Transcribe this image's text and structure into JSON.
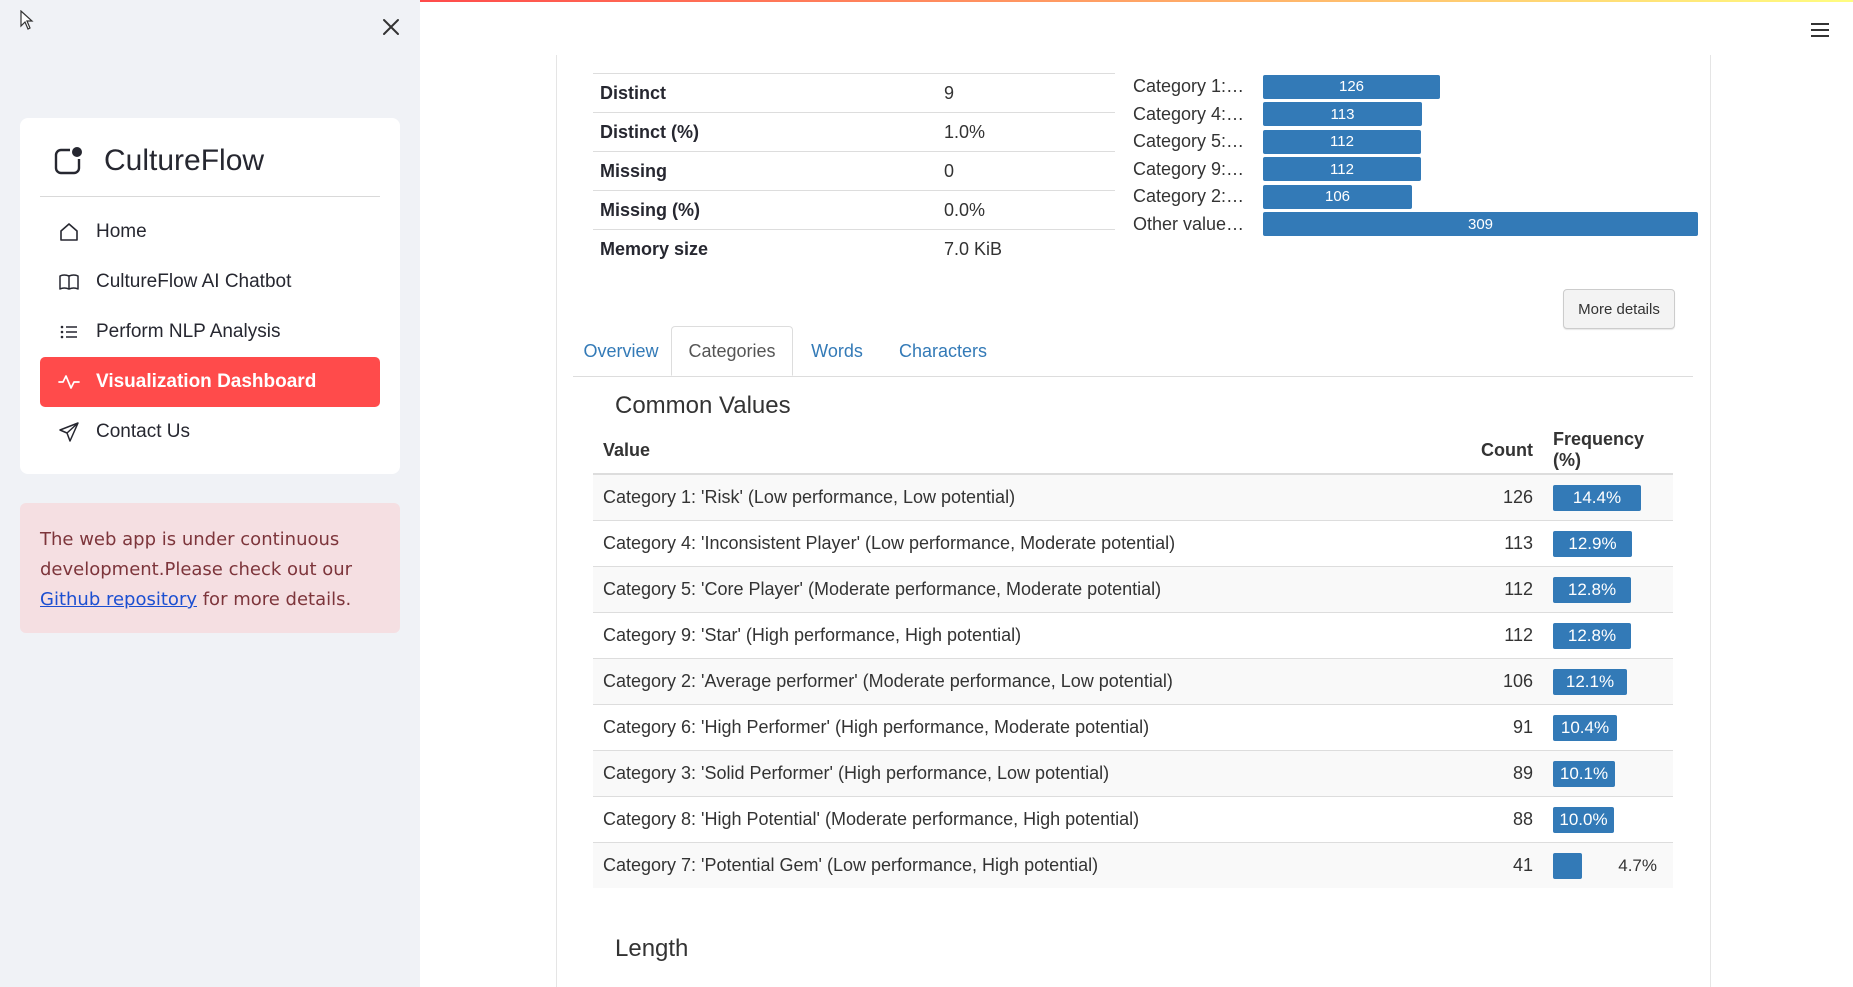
{
  "sidebar": {
    "brand": "CultureFlow",
    "nav": [
      {
        "label": "Home",
        "icon": "house-icon",
        "active": false
      },
      {
        "label": "CultureFlow AI Chatbot",
        "icon": "book-icon",
        "active": false
      },
      {
        "label": "Perform NLP Analysis",
        "icon": "list-icon",
        "active": false
      },
      {
        "label": "Visualization Dashboard",
        "icon": "activity-icon",
        "active": true
      },
      {
        "label": "Contact Us",
        "icon": "send-icon",
        "active": false
      }
    ],
    "notice": {
      "before": "The web app is under continuous development.Please check out our ",
      "link": "Github repository",
      "after": " for more details."
    }
  },
  "stats": [
    {
      "key": "Distinct",
      "value": "9"
    },
    {
      "key": "Distinct (%)",
      "value": "1.0%"
    },
    {
      "key": "Missing",
      "value": "0"
    },
    {
      "key": "Missing (%)",
      "value": "0.0%"
    },
    {
      "key": "Memory size",
      "value": "7.0 KiB"
    }
  ],
  "mini_chart": [
    {
      "label": "Category 1:…",
      "value": 126
    },
    {
      "label": "Category 4:…",
      "value": 113
    },
    {
      "label": "Category 5:…",
      "value": 112
    },
    {
      "label": "Category 9:…",
      "value": 112
    },
    {
      "label": "Category 2:…",
      "value": 106
    },
    {
      "label": "Other value…",
      "value": 309
    }
  ],
  "more_details_label": "More details",
  "tabs": [
    {
      "label": "Overview",
      "active": false
    },
    {
      "label": "Categories",
      "active": true
    },
    {
      "label": "Words",
      "active": false
    },
    {
      "label": "Characters",
      "active": false
    }
  ],
  "common_values": {
    "title": "Common Values",
    "headers": {
      "value": "Value",
      "count": "Count",
      "frequency": "Frequency (%)"
    },
    "rows": [
      {
        "value": "Category 1: 'Risk' (Low performance, Low potential)",
        "count": "126",
        "frequency": "14.4%",
        "pct": 14.4
      },
      {
        "value": "Category 4: 'Inconsistent Player' (Low performance, Moderate potential)",
        "count": "113",
        "frequency": "12.9%",
        "pct": 12.9
      },
      {
        "value": "Category 5: 'Core Player' (Moderate performance, Moderate potential)",
        "count": "112",
        "frequency": "12.8%",
        "pct": 12.8
      },
      {
        "value": "Category 9: 'Star' (High performance, High potential)",
        "count": "112",
        "frequency": "12.8%",
        "pct": 12.8
      },
      {
        "value": "Category 2: 'Average performer' (Moderate performance, Low potential)",
        "count": "106",
        "frequency": "12.1%",
        "pct": 12.1
      },
      {
        "value": "Category 6: 'High Performer' (High performance, Moderate potential)",
        "count": "91",
        "frequency": "10.4%",
        "pct": 10.4
      },
      {
        "value": "Category 3: 'Solid Performer' (High performance, Low potential)",
        "count": "89",
        "frequency": "10.1%",
        "pct": 10.1
      },
      {
        "value": "Category 8: 'High Potential' (Moderate performance, High potential)",
        "count": "88",
        "frequency": "10.0%",
        "pct": 10.0
      },
      {
        "value": "Category 7: 'Potential Gem' (Low performance, High potential)",
        "count": "41",
        "frequency": "4.7%",
        "pct": 4.7
      }
    ]
  },
  "length_title": "Length",
  "colors": {
    "accent": "#ff4b4b",
    "bar": "#337ab7",
    "sidebar_bg": "#f0f2f6",
    "notice_bg": "#f5dfe2"
  }
}
